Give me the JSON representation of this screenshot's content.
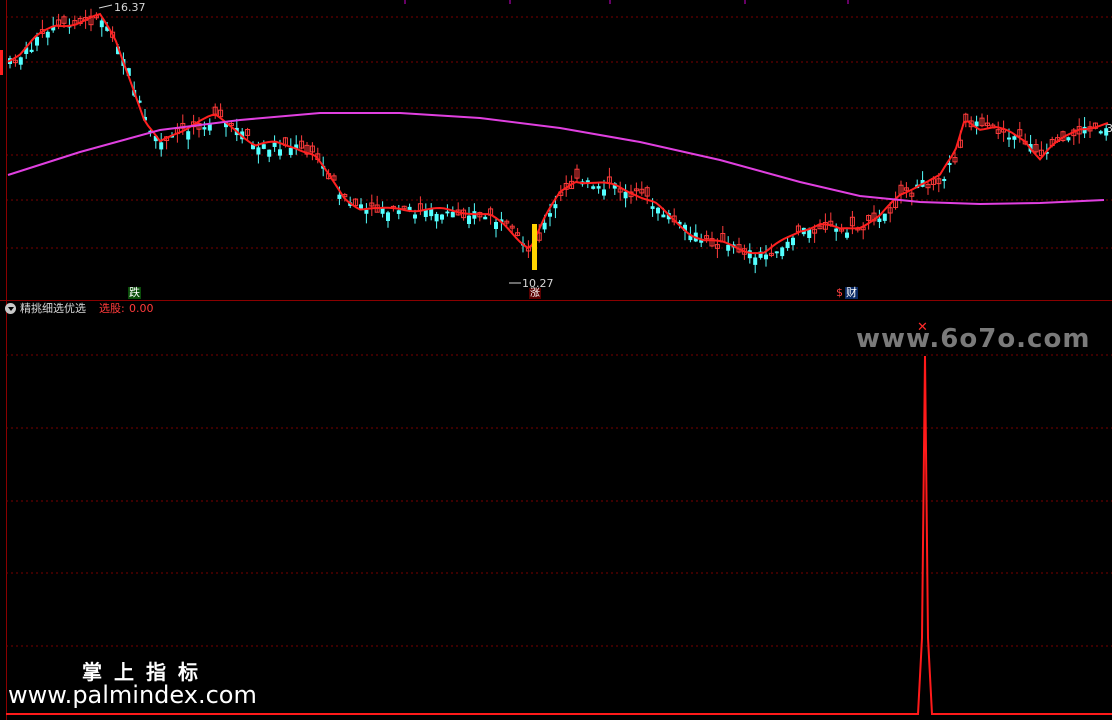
{
  "main_chart": {
    "high_label": "16.37",
    "low_label": "10.27",
    "right_edge_value": "3",
    "signals": {
      "fall": "跌",
      "up": "涨",
      "money_icon": "$",
      "money": "财"
    }
  },
  "indicator": {
    "name": "精挑细选优选",
    "select_label": "选股:",
    "select_value": "0.00",
    "marker": "✕"
  },
  "watermarks": {
    "site1": "www.6o7o.com",
    "cn_title": "掌上指标",
    "site2": "www.palmindex.com"
  },
  "colors": {
    "bull_candle": "#ff3b3b",
    "bear_candle": "#54ffff",
    "ma_short": "#ff2020",
    "ma_long": "#e040e0",
    "grid": "#7a0000",
    "signal_line": "#ff1a1a",
    "highlight_bar": "#ffd400"
  }
}
